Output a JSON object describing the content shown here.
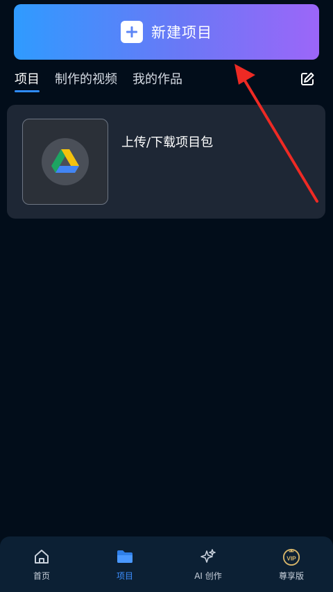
{
  "header": {
    "new_project_label": "新建项目"
  },
  "tabs": [
    {
      "label": "项目",
      "active": true
    },
    {
      "label": "制作的视频",
      "active": false
    },
    {
      "label": "我的作品",
      "active": false
    }
  ],
  "card": {
    "title": "上传/下载项目包",
    "thumb_icon": "google-drive-icon"
  },
  "bottom_nav": [
    {
      "label": "首页",
      "icon": "home-icon",
      "active": false
    },
    {
      "label": "项目",
      "icon": "folder-icon",
      "active": true
    },
    {
      "label": "AI 创作",
      "icon": "sparkle-icon",
      "active": false
    },
    {
      "label": "尊享版",
      "icon": "vip-icon",
      "active": false
    }
  ],
  "colors": {
    "background": "#020d1a",
    "accent": "#2f8cff",
    "gradient_start": "#2f9bff",
    "gradient_end": "#9c66f8",
    "card": "#1e2735",
    "nav_bg": "#0c2034",
    "vip_gold": "#d8b66a",
    "annotation_red": "#ee2a24"
  }
}
